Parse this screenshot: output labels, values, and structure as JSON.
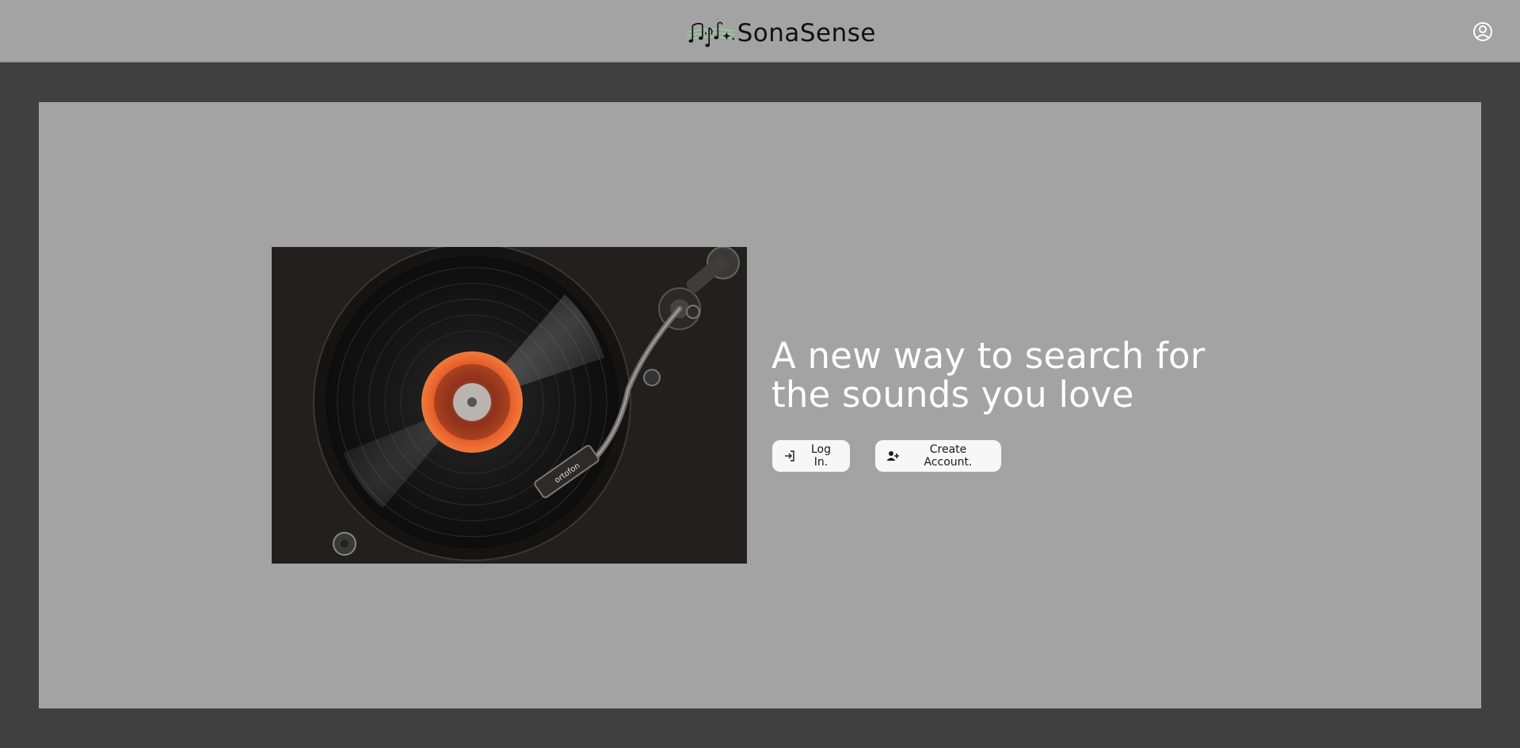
{
  "header": {
    "brand": "SonaSense",
    "icons": {
      "logo": "music-notes-icon",
      "profile": "user-circle-icon"
    }
  },
  "hero": {
    "image_alt": "turntable with spinning vinyl record",
    "headline": "A new way to search for the sounds you love",
    "login_label": "Log In.",
    "create_label": "Create Account.",
    "icons": {
      "login": "log-in-icon",
      "create": "user-plus-icon"
    }
  },
  "colors": {
    "page_background": "#404040",
    "panel_background": "#a3a3a3",
    "button_background": "#f7f7f7",
    "headline_text": "#ffffff",
    "logo_staff_green": "#8fd39a",
    "record_label_orange": "#e8622c"
  }
}
